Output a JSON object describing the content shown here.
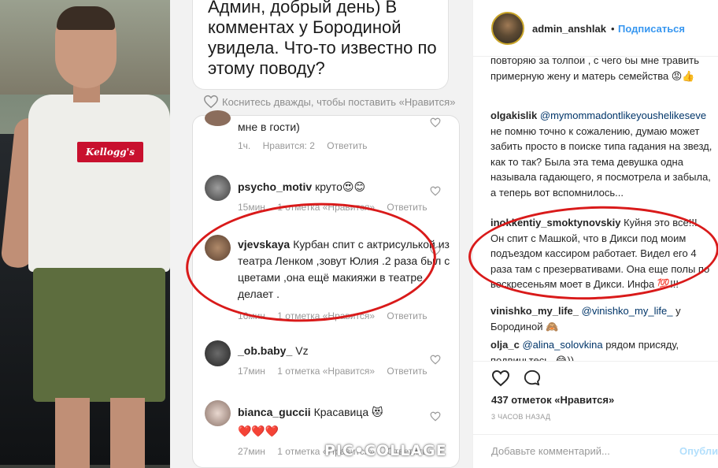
{
  "post_image": {
    "left_photo": {
      "shirt_logo": "Kellogg's"
    },
    "caption_text": "Админ, добрый день) В комментах у Бородиной увидела. Что-то известно по этому поводу?",
    "like_hint": "Коснитесь дважды, чтобы поставить «Нравится»",
    "comments": [
      {
        "user": "",
        "text": "мне в гости)",
        "time": "1ч.",
        "likes": "Нравится: 2",
        "reply": "Ответить"
      },
      {
        "user": "psycho_motiv",
        "text": "круто😍😊",
        "time": "15мин",
        "likes": "1 отметка «Нравится»",
        "reply": "Ответить"
      },
      {
        "user": "vjevskaya",
        "text": "Курбан спит с актрисулькой из театра Ленком ,зовут Юлия .2 раза был с цветами ,она ещё макияжи в театре делает .",
        "time": "16мин",
        "likes": "1 отметка «Нравится»",
        "reply": "Ответить"
      },
      {
        "user": "_ob.baby_",
        "text": "Vz",
        "time": "17мин",
        "likes": "1 отметка «Нравится»",
        "reply": "Ответить"
      },
      {
        "user": "bianca_guccii",
        "text": "Красавица 😻 ❤️❤️❤️",
        "time": "27мин",
        "likes": "1 отметка «Нравится»",
        "reply": "Ответить"
      }
    ],
    "watermark": "PIC•COLLAGE"
  },
  "instagram": {
    "username": "admin_anshlak",
    "separator": "•",
    "follow_label": "Подписаться",
    "comments": [
      {
        "user": "",
        "text": "повторяю за толпой , с чего бы мне травить примерную жену и матерь семейства 😡👍"
      },
      {
        "user": "olgakislik",
        "mention": "@mymommadontlikeyoushelikeseve",
        "text": "не помню точно к сожалению, думаю может забить просто в поиске типа гадания на звезд, как то так? Была эта тема девушка одна называла гадающего, я посмотрела и забыла, а теперь вот вспомнилось..."
      },
      {
        "user": "inokkentiy_smoktynovskiy",
        "text": "Куйня это все!!! Он спит с Машкой, что в Дикси под моим подъездом кассиром работает. Видел его 4 раза там с презервативами. Она еще полы по воскресеньям моет в Дикси. Инфа 💯!!!"
      },
      {
        "user": "vinishko_my_life_",
        "mention": "@vinishko_my_life_",
        "text": "у Бородиной 🙈"
      },
      {
        "user": "olja_c",
        "mention": "@alina_solovkina",
        "text": "рядом присяду, подвиньтесь. 😂))"
      }
    ],
    "likes_count": "437 отметок «Нравится»",
    "time_ago": "3 часов назад",
    "add_comment_placeholder": "Добавьте комментарий...",
    "publish_label": "Опубликовать",
    "accent_color": "#3897f0"
  }
}
